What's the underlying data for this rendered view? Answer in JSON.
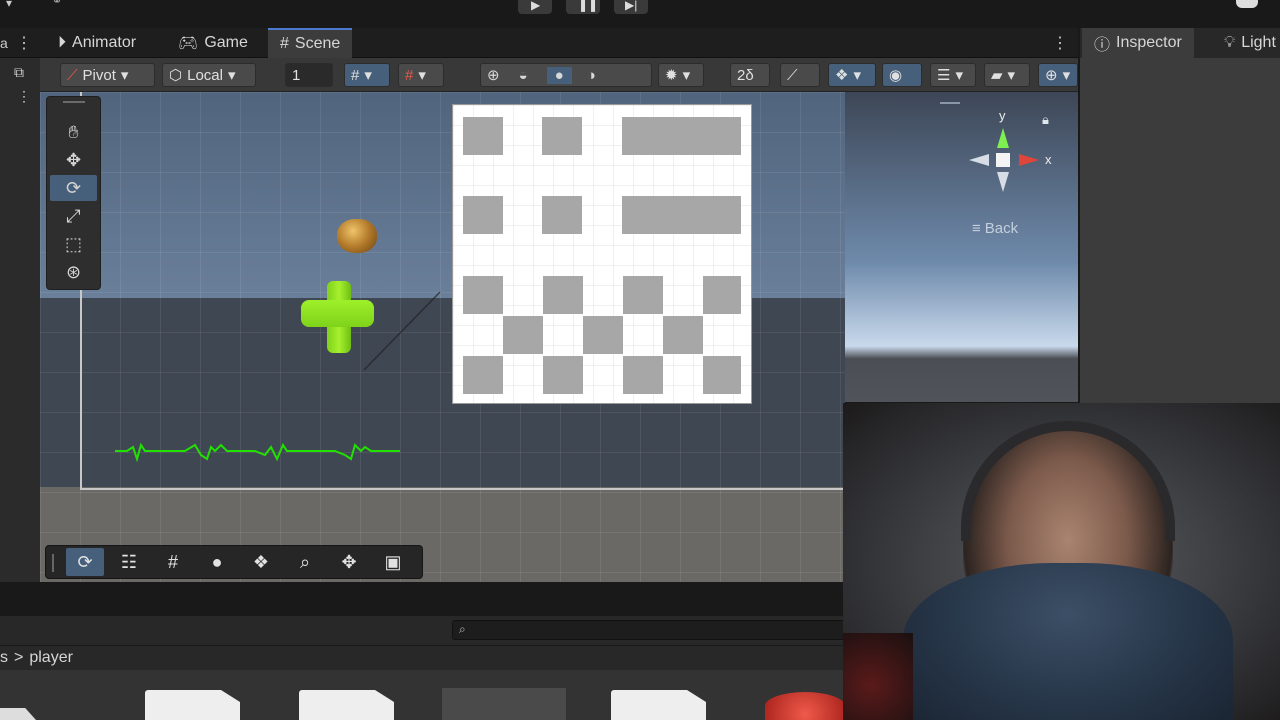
{
  "tabs": {
    "animator": "Animator",
    "game": "Game",
    "scene": "Scene",
    "inspector": "Inspector",
    "lighting": "Light"
  },
  "toolbar": {
    "pivot": "Pivot",
    "local": "Local",
    "grid_snap_value": "1"
  },
  "gizmo": {
    "y_label": "y",
    "x_label": "x",
    "view_label": "Back"
  },
  "project": {
    "breadcrumb_prev": "s",
    "breadcrumb_sep": ">",
    "breadcrumb_current": "player"
  },
  "colors": {
    "accent_blue": "#46607c",
    "waveform_green": "#22e000",
    "cross_green": "#8fe01c"
  },
  "icons": {
    "palette": [
      "hand-icon",
      "move-icon",
      "rotate-icon",
      "scale-icon",
      "rect-icon",
      "transform-icon"
    ],
    "overlay": [
      "rotate-icon",
      "sliders-icon",
      "grid-icon",
      "sphere-icon",
      "layers-icon",
      "search-icon",
      "move-icon",
      "camera-icon"
    ]
  }
}
